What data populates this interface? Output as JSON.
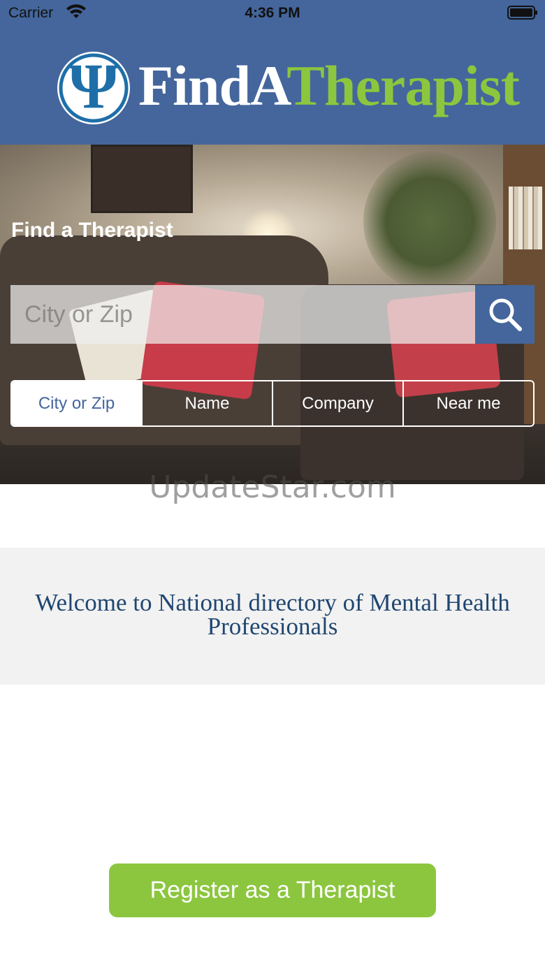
{
  "status_bar": {
    "carrier": "Carrier",
    "time": "4:36 PM"
  },
  "header": {
    "logo_find": "Find",
    "logo_a": "A",
    "logo_therapist": "Therapist",
    "logo_symbol": "Ψ"
  },
  "hero": {
    "title": "Find a Therapist",
    "search_placeholder": "City or Zip",
    "tabs": [
      {
        "label": "City or Zip",
        "active": true
      },
      {
        "label": "Name",
        "active": false
      },
      {
        "label": "Company",
        "active": false
      },
      {
        "label": "Near me",
        "active": false
      }
    ]
  },
  "watermark": "UpdateStar.com",
  "welcome": {
    "text": "Welcome to  National directory of Mental Health Professionals"
  },
  "register_button": {
    "label": "Register as a Therapist"
  },
  "colors": {
    "brand_blue": "#44669c",
    "brand_green": "#8cc63f",
    "welcome_text": "#1f4670"
  },
  "icons": {
    "search": "search-icon",
    "wifi": "wifi-icon",
    "battery": "battery-icon",
    "logo": "psi-logo-icon"
  }
}
